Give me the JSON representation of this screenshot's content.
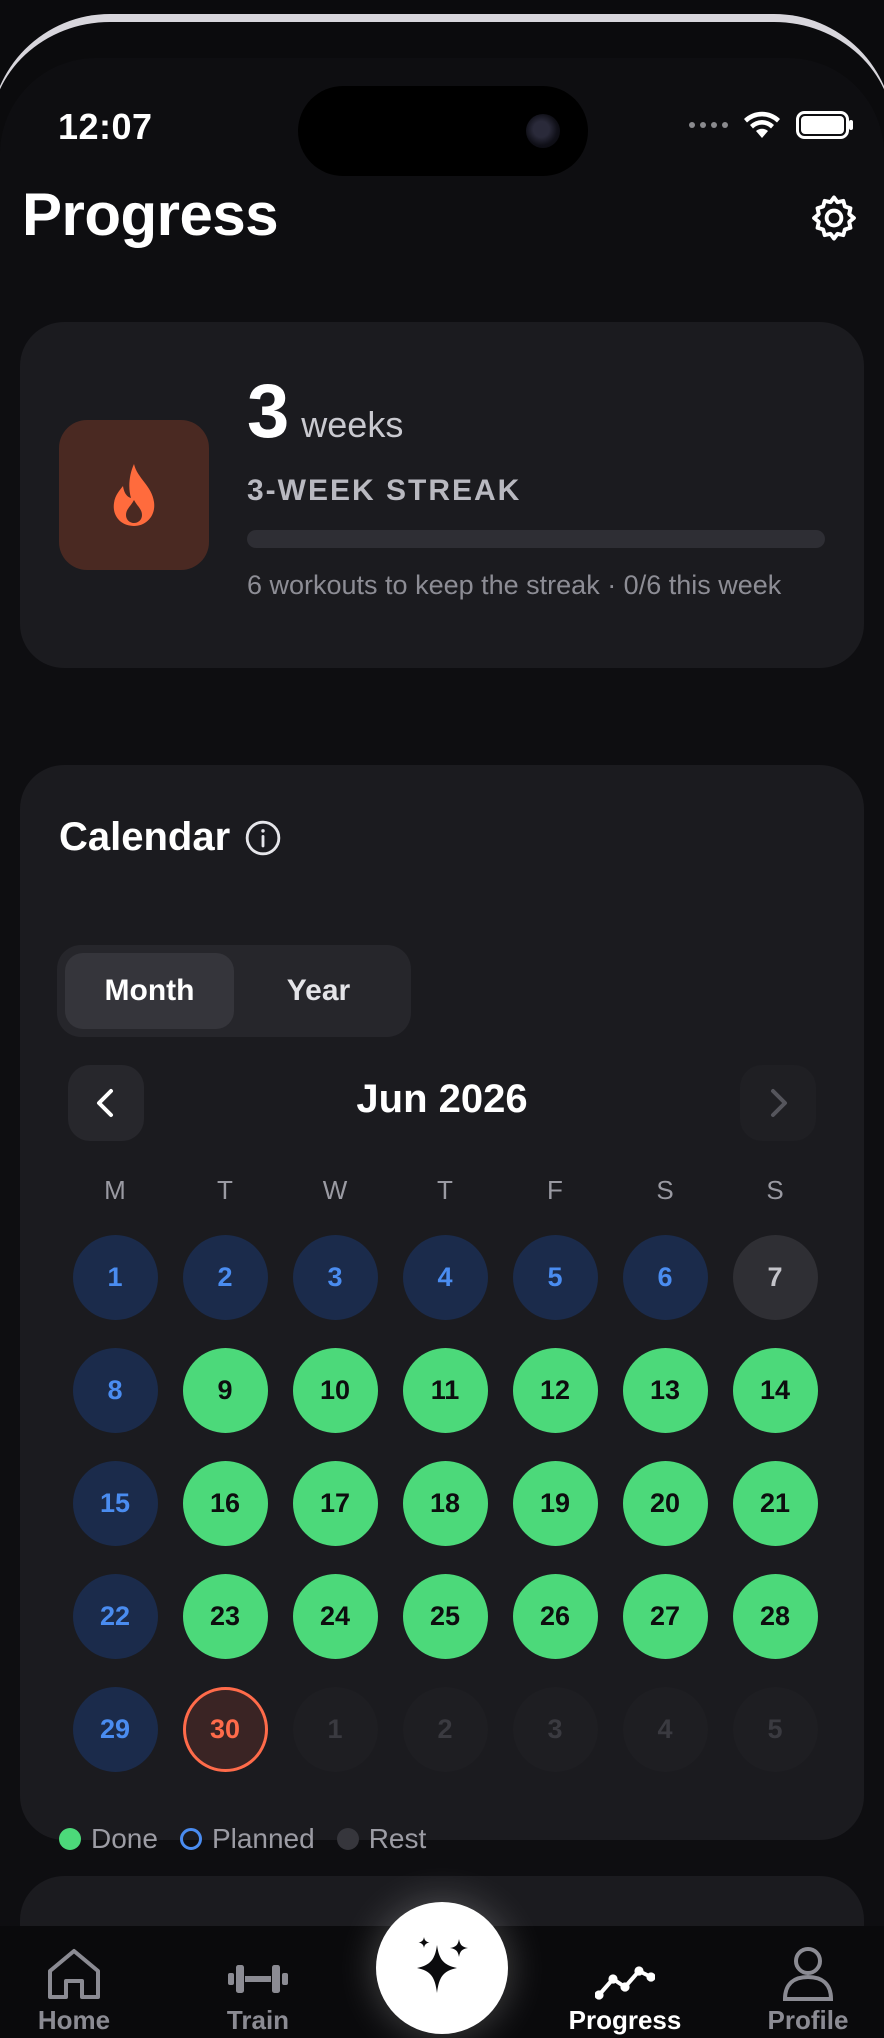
{
  "status_bar": {
    "time": "12:07"
  },
  "header": {
    "title": "Progress",
    "settings_icon": "gear-icon"
  },
  "streak": {
    "count": "3",
    "unit": "weeks",
    "label": "3-WEEK STREAK",
    "progress_fraction": 0,
    "subtext": "6 workouts to keep the streak · 0/6 this week",
    "icon": "flame-icon",
    "accent_color": "#ff6b3d"
  },
  "calendar": {
    "title": "Calendar",
    "info_icon": "info-icon",
    "segments": {
      "month": "Month",
      "year": "Year",
      "selected": "Month"
    },
    "month_label": "Jun 2026",
    "weekdays": [
      "M",
      "T",
      "W",
      "T",
      "F",
      "S",
      "S"
    ],
    "days": [
      {
        "label": "1",
        "status": "planned"
      },
      {
        "label": "2",
        "status": "planned"
      },
      {
        "label": "3",
        "status": "planned"
      },
      {
        "label": "4",
        "status": "planned"
      },
      {
        "label": "5",
        "status": "planned"
      },
      {
        "label": "6",
        "status": "planned"
      },
      {
        "label": "7",
        "status": "rest"
      },
      {
        "label": "8",
        "status": "planned"
      },
      {
        "label": "9",
        "status": "done"
      },
      {
        "label": "10",
        "status": "done"
      },
      {
        "label": "11",
        "status": "done"
      },
      {
        "label": "12",
        "status": "done"
      },
      {
        "label": "13",
        "status": "done"
      },
      {
        "label": "14",
        "status": "done"
      },
      {
        "label": "15",
        "status": "planned"
      },
      {
        "label": "16",
        "status": "done"
      },
      {
        "label": "17",
        "status": "done"
      },
      {
        "label": "18",
        "status": "done"
      },
      {
        "label": "19",
        "status": "done"
      },
      {
        "label": "20",
        "status": "done"
      },
      {
        "label": "21",
        "status": "done"
      },
      {
        "label": "22",
        "status": "planned"
      },
      {
        "label": "23",
        "status": "done"
      },
      {
        "label": "24",
        "status": "done"
      },
      {
        "label": "25",
        "status": "done"
      },
      {
        "label": "26",
        "status": "done"
      },
      {
        "label": "27",
        "status": "done"
      },
      {
        "label": "28",
        "status": "done"
      },
      {
        "label": "29",
        "status": "planned"
      },
      {
        "label": "30",
        "status": "today"
      },
      {
        "label": "1",
        "status": "next"
      },
      {
        "label": "2",
        "status": "next"
      },
      {
        "label": "3",
        "status": "next"
      },
      {
        "label": "4",
        "status": "next"
      },
      {
        "label": "5",
        "status": "next"
      }
    ],
    "legend": {
      "done": "Done",
      "planned": "Planned",
      "rest": "Rest"
    },
    "colors": {
      "done": "#4cd97a",
      "planned": "#4a8cf0",
      "today": "#ff6b4a"
    }
  },
  "tabbar": {
    "home": "Home",
    "train": "Train",
    "progress": "Progress",
    "profile": "Profile",
    "active": "Progress",
    "ai_icon": "sparkles-icon"
  }
}
